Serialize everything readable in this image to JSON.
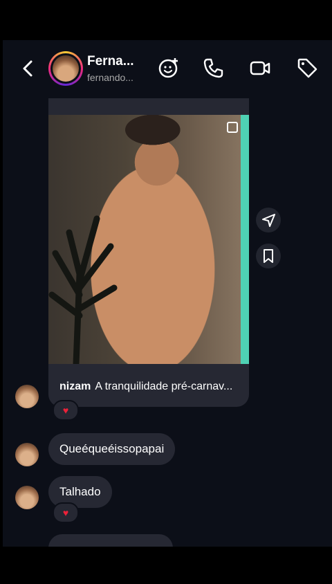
{
  "header": {
    "name": "Ferna...",
    "username": "fernando...",
    "icons": [
      "back-arrow-icon",
      "sticker-add-icon",
      "phone-icon",
      "video-camera-icon",
      "tag-icon"
    ]
  },
  "post": {
    "author": "nizam",
    "caption": "A tranquilidade pré-carnav..."
  },
  "messages": [
    {
      "text": "Queéqueéissopapai"
    },
    {
      "text": "Talhado"
    }
  ],
  "reactions": {
    "emoji": "♥"
  },
  "colors": {
    "background": "#0c0f18",
    "bubble": "#262833",
    "accent_stripe": "#4fd1b4",
    "heart": "#ed2139"
  }
}
